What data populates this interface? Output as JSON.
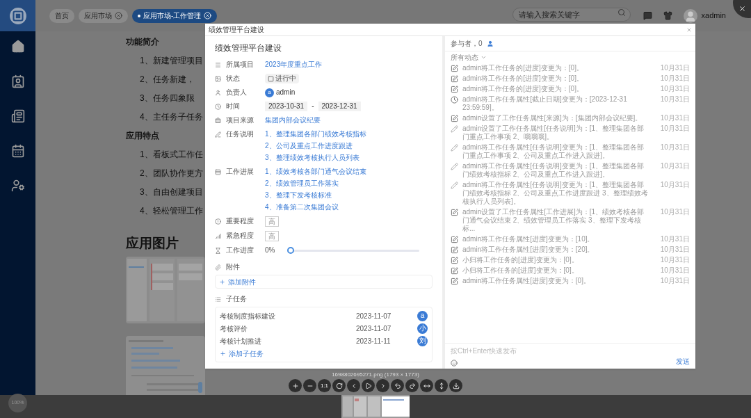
{
  "top_bar": {
    "tabs": [
      {
        "label": "首页",
        "closable": false,
        "selected": false
      },
      {
        "label": "应用市场",
        "closable": true,
        "selected": false
      },
      {
        "label": "应用市场-工作管理",
        "closable": true,
        "selected": true
      }
    ],
    "search": {
      "placeholder": "请输入搜索关键字"
    },
    "user": "xadmin"
  },
  "article": {
    "sections": [
      {
        "heading": "功能简介",
        "items": [
          "1、新建管理项目",
          "2、任务新建，",
          "3、任务四象限",
          "4、主任务子任务"
        ]
      },
      {
        "heading": "应用特点",
        "items": [
          "1、看板式工作任",
          "2、团队协作更方",
          "3、自由创建项目",
          "4、轻松管理工作"
        ]
      }
    ],
    "gallery_heading": "应用图片"
  },
  "dialog": {
    "title": "绩效管理平台建设",
    "heading": "绩效管理平台建设",
    "fields": [
      {
        "kind": "link",
        "label": "所属项目",
        "value": "2023年度重点工作"
      },
      {
        "kind": "status",
        "label": "状态",
        "value": "进行中",
        "checked": false
      },
      {
        "kind": "person",
        "label": "负责人",
        "avatar": "a",
        "value": "admin"
      },
      {
        "kind": "dates",
        "label": "时间",
        "start": "2023-10-31",
        "separator": "-",
        "end": "2023-12-31"
      },
      {
        "kind": "link",
        "label": "项目来源",
        "value": "集团内部会议纪要"
      },
      {
        "kind": "list",
        "label": "任务说明",
        "lines": [
          "1、整理集团各部门绩效考核指标",
          "2、公司及重点工作进度跟进",
          "3、整理绩效考核执行人员列表"
        ]
      },
      {
        "kind": "list",
        "label": "工作进展",
        "lines": [
          "1、绩效考核各部门通气会议结束",
          "2、绩效管理员工作落实",
          "3、整理下发考核标准",
          "4、准备第二次集团会议"
        ]
      },
      {
        "kind": "tag",
        "label": "重要程度",
        "value": "高"
      },
      {
        "kind": "tag",
        "label": "紧急程度",
        "value": "高"
      },
      {
        "kind": "progress",
        "label": "工作进度",
        "reading": "0%",
        "level": 0
      }
    ],
    "attachments": {
      "label": "附件",
      "add": "添加附件"
    },
    "subtasks": {
      "label": "子任务",
      "rows": [
        {
          "name": "考核制度指标建设",
          "date": "2023-11-07",
          "avatar": "a"
        },
        {
          "name": "考核评价",
          "date": "2023-11-07",
          "avatar": "小"
        },
        {
          "name": "考核计划推进",
          "date": "2023-11-11",
          "avatar": "刘"
        }
      ],
      "add": "添加子任务"
    },
    "activity": {
      "participants": "参与者，0",
      "filter": "所有动态",
      "items": [
        {
          "kind": "edit",
          "text": "admin将工作任务的[进度]变更为：[0]。",
          "date": "10月31日"
        },
        {
          "kind": "edit",
          "text": "admin将工作任务的[进度]变更为：[0]。",
          "date": "10月31日"
        },
        {
          "kind": "edit",
          "text": "admin将工作任务的[进度]变更为：[0]。",
          "date": "10月31日"
        },
        {
          "kind": "clock",
          "text": "admin将工作任务属性[截止日期]变更为：[2023-12-31 23:59:59]。",
          "date": "10月31日"
        },
        {
          "kind": "edit",
          "text": "admin设置了工作任务属性[来源]为：[集团内部会议纪要]。",
          "date": "10月31日"
        },
        {
          "kind": "pencil",
          "text": "admin设置了工作任务属性[任务说明]为：[1、整理集团各部门重点工作事项 2、哦哦哦]。",
          "date": "10月31日"
        },
        {
          "kind": "pencil",
          "text": "admin将工作任务属性[任务说明]变更为：[1、整理集团各部门重点工作事项 2、公司及重点工作进入跟进]。",
          "date": "10月31日"
        },
        {
          "kind": "pencil",
          "text": "admin将工作任务属性[任务说明]变更为：[1、整理集团各部门绩效考核指标 2、公司及重点工作进入跟进]。",
          "date": "10月31日"
        },
        {
          "kind": "pencil",
          "text": "admin将工作任务属性[任务说明]变更为：[1、整理集团各部门绩效考核指标 2、公司及重点工作进度跟进 3、整理绩效考核执行人员列表]。",
          "date": "10月31日"
        },
        {
          "kind": "edit",
          "text": "admin设置了工作任务属性[工作进展]为：[1、绩效考核各部门通气会议结束 2、绩效管理员工作落实 3、整理下发考核标...",
          "date": "10月31日"
        },
        {
          "kind": "edit",
          "text": "admin将工作任务属性[进度]变更为：[10]。",
          "date": "10月31日"
        },
        {
          "kind": "edit",
          "text": "admin将工作任务属性[进度]变更为：[20]。",
          "date": "10月31日"
        },
        {
          "kind": "edit",
          "text": "小归将工作任务的[进度]变更为：[0]。",
          "date": "10月31日"
        },
        {
          "kind": "edit",
          "text": "小归将工作任务的[进度]变更为：[0]。",
          "date": "10月31日"
        },
        {
          "kind": "edit",
          "text": "admin将工作任务属性[进度]变更为：[0]。",
          "date": "10月31日"
        }
      ],
      "input": {
        "placeholder": "按Ctrl+Enter快速发布"
      },
      "send": "发送"
    }
  },
  "viewer": {
    "caption": "1698802695271.png (1793 × 1773)",
    "zoom": "100%",
    "toolbar": [
      {
        "kind": "zoom-in"
      },
      {
        "kind": "zoom-out"
      },
      {
        "kind": "actual-size",
        "label": "1:1"
      },
      {
        "kind": "reset"
      },
      {
        "kind": "prev"
      },
      {
        "kind": "play"
      },
      {
        "kind": "next"
      },
      {
        "kind": "rotate-left"
      },
      {
        "kind": "rotate-right"
      },
      {
        "kind": "flip-h"
      },
      {
        "kind": "flip-v"
      },
      {
        "kind": "download"
      }
    ]
  }
}
